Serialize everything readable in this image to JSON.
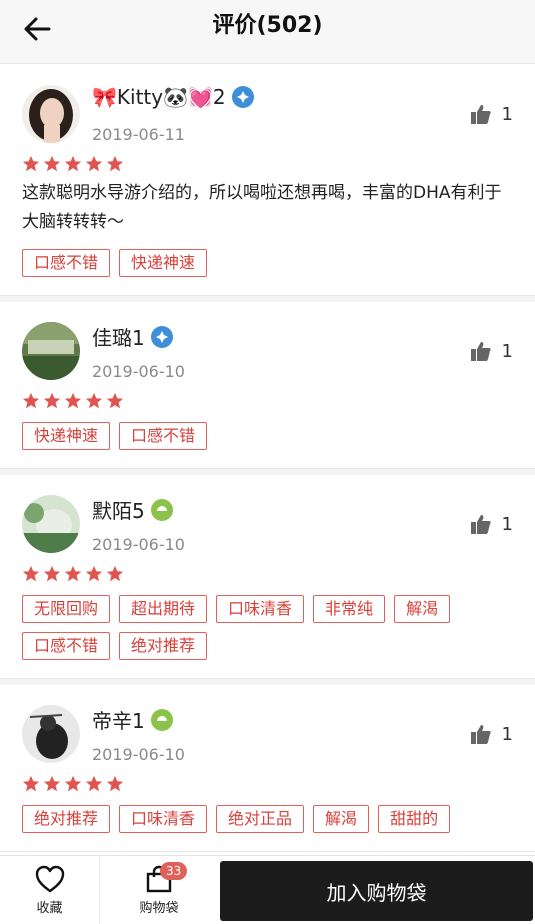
{
  "header": {
    "title": "评价(502)"
  },
  "reviews": [
    {
      "username": "🎀Kitty🐼💓2",
      "date": "2019-06-11",
      "likes": "1",
      "rating": 5,
      "content": "这款聪明水导游介绍的，所以喝啦还想再喝，丰富的DHA有利于大脑转转转～",
      "tags": [
        "口感不错",
        "快递神速"
      ]
    },
    {
      "username": "佳璐1",
      "date": "2019-06-10",
      "likes": "1",
      "rating": 5,
      "content": "",
      "tags": [
        "快递神速",
        "口感不错"
      ]
    },
    {
      "username": "默陌5",
      "date": "2019-06-10",
      "likes": "1",
      "rating": 5,
      "content": "",
      "tags": [
        "无限回购",
        "超出期待",
        "口味清香",
        "非常纯",
        "解渴",
        "口感不错",
        "绝对推荐"
      ]
    },
    {
      "username": "帝辛1",
      "date": "2019-06-10",
      "likes": "1",
      "rating": 5,
      "content": "",
      "tags": [
        "绝对推荐",
        "口味清香",
        "绝对正品",
        "解渴",
        "甜甜的"
      ]
    }
  ],
  "footer": {
    "favorite_label": "收藏",
    "bag_label": "购物袋",
    "bag_count": "33",
    "add_to_bag_label": "加入购物袋"
  },
  "colors": {
    "accent": "#e0605a",
    "button_dark": "#1c1c1c"
  }
}
